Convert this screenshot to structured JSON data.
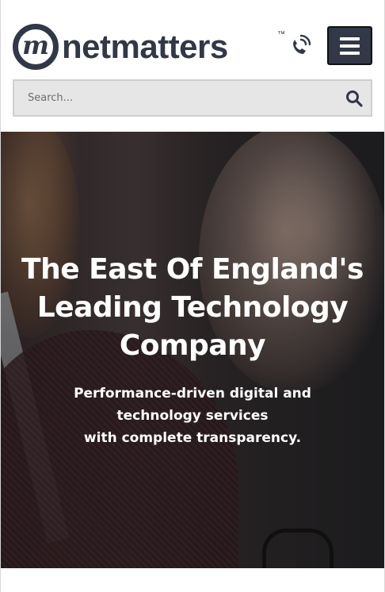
{
  "header": {
    "logo_text": "netmatters",
    "logo_mark": "m",
    "trademark": "™",
    "phone_icon": "phone-icon",
    "menu_icon": "hamburger-icon"
  },
  "search": {
    "placeholder": "Search...",
    "icon": "search-icon"
  },
  "hero": {
    "title": "The East Of England's Leading Technology Company",
    "subtitle_lines": [
      "Performance-driven digital and",
      "technology services",
      "with complete transparency."
    ]
  },
  "colors": {
    "brand_dark": "#323847",
    "search_bg": "#e6e6e6",
    "hero_text": "#ffffff"
  }
}
